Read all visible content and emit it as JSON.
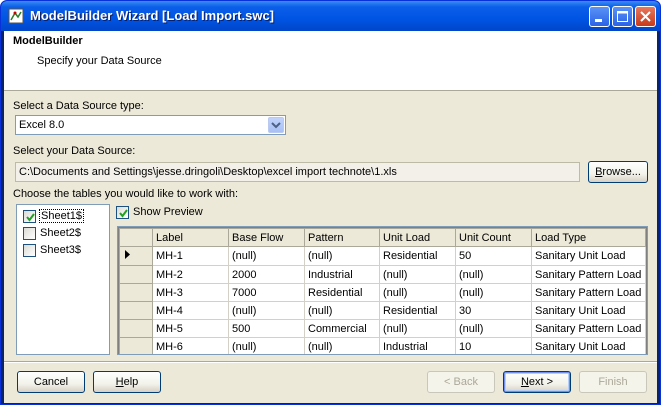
{
  "window": {
    "title": "ModelBuilder Wizard [Load Import.swc]"
  },
  "header": {
    "title": "ModelBuilder",
    "subtitle": "Specify your Data Source"
  },
  "source_type": {
    "label": "Select a Data Source type:",
    "value": "Excel 8.0"
  },
  "source": {
    "label": "Select your Data Source:",
    "path": "C:\\Documents and Settings\\jesse.dringoli\\Desktop\\excel import technote\\1.xls",
    "browse_label": "Browse..."
  },
  "tables": {
    "label": "Choose the tables you would like to work with:",
    "items": [
      {
        "name": "Sheet1$",
        "checked": true
      },
      {
        "name": "Sheet2$",
        "checked": false
      },
      {
        "name": "Sheet3$",
        "checked": false
      }
    ]
  },
  "preview": {
    "label": "Show Preview",
    "checked": true,
    "columns": [
      "Label",
      "Base Flow",
      "Pattern",
      "Unit Load",
      "Unit Count",
      "Load Type"
    ],
    "rows": [
      [
        "MH-1",
        "(null)",
        "(null)",
        "Residential",
        "50",
        "Sanitary Unit Load"
      ],
      [
        "MH-2",
        "2000",
        "Industrial",
        "(null)",
        "(null)",
        "Sanitary Pattern Load"
      ],
      [
        "MH-3",
        "7000",
        "Residential",
        "(null)",
        "(null)",
        "Sanitary Pattern Load"
      ],
      [
        "MH-4",
        "(null)",
        "(null)",
        "Residential",
        "30",
        "Sanitary Unit Load"
      ],
      [
        "MH-5",
        "500",
        "Commercial",
        "(null)",
        "(null)",
        "Sanitary Pattern Load"
      ],
      [
        "MH-6",
        "(null)",
        "(null)",
        "Industrial",
        "10",
        "Sanitary Unit Load"
      ]
    ]
  },
  "footer": {
    "cancel": "Cancel",
    "help": "Help",
    "back": "< Back",
    "next": "Next >",
    "finish": "Finish"
  }
}
